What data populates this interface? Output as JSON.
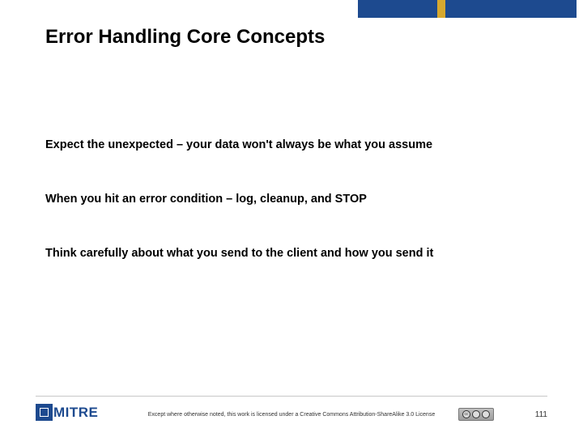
{
  "title": "Error Handling Core Concepts",
  "bullets": [
    "Expect the unexpected – your data won't always be what you assume",
    "When you hit an error condition – log, cleanup, and STOP",
    "Think carefully about what you send to the client and how you send it"
  ],
  "footer": {
    "logo_text": "MITRE",
    "license": "Except where otherwise noted, this work is licensed under a Creative Commons Attribution-ShareAlike 3.0 License",
    "page_number": "111"
  }
}
